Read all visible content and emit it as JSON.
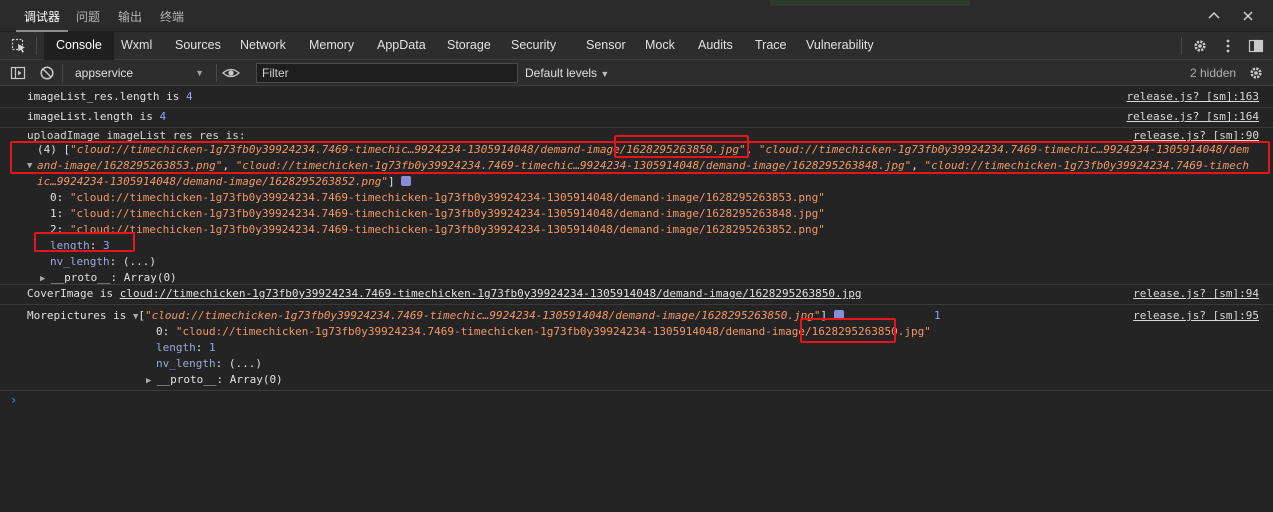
{
  "panel_tabs": [
    "调试器",
    "问题",
    "输出",
    "终端"
  ],
  "top_strip_text": "",
  "devtools_tabs": [
    "Console",
    "Wxml",
    "Sources",
    "Network",
    "Memory",
    "AppData",
    "Storage",
    "Security",
    "Sensor",
    "Mock",
    "Audits",
    "Trace",
    "Vulnerability"
  ],
  "toolbar": {
    "context": "appservice",
    "filter_placeholder": "Filter",
    "levels": "Default levels",
    "hidden": "2 hidden"
  },
  "console": {
    "m1": {
      "text": "imageList_res.length is ",
      "value": "4",
      "source": "release.js? [sm]:163"
    },
    "m2": {
      "text": "imageList.length is ",
      "value": "4",
      "source": "release.js? [sm]:164"
    },
    "m3": {
      "label": "uploadImage imageList_res_res is:",
      "source": "release.js? [sm]:90",
      "count": "(4) [",
      "line1_a": "\"cloud://timechicken-1g73fb0y39924234.7469-timechic…9924234-1305914048/demand-image/1628295263850.jpg\"",
      "line1_b": ", ",
      "line1_c": "\"cloud://timechicken-1g73fb0y39924234.7469-timechic…9924234-1305914048/dem",
      "line2_a": "and-image/1628295263853.png\"",
      "line2_b": ", ",
      "line2_c": "\"cloud://timechicken-1g73fb0y39924234.7469-timechic…9924234-1305914048/demand-image/1628295263848.jpg\"",
      "line2_d": ", ",
      "line2_e": "\"cloud://timechicken-1g73fb0y39924234.7469-timech",
      "line3_a": "ic…9924234-1305914048/demand-image/1628295263852.png\"",
      "line3_b": "]",
      "items": [
        {
          "key": "0",
          "value": "\"cloud://timechicken-1g73fb0y39924234.7469-timechicken-1g73fb0y39924234-1305914048/demand-image/1628295263853.png\""
        },
        {
          "key": "1",
          "value": "\"cloud://timechicken-1g73fb0y39924234.7469-timechicken-1g73fb0y39924234-1305914048/demand-image/1628295263848.jpg\""
        },
        {
          "key": "2",
          "value": "\"cloud://timechicken-1g73fb0y39924234.7469-timechicken-1g73fb0y39924234-1305914048/demand-image/1628295263852.png\""
        }
      ],
      "length_key": "length",
      "length_val": "3",
      "nv_key": "nv_length",
      "nv_val": "(...)",
      "proto_key": "__proto__",
      "proto_val": "Array(0)"
    },
    "m4": {
      "label": "CoverImage is ",
      "link": "cloud://timechicken-1g73fb0y39924234.7469-timechicken-1g73fb0y39924234-1305914048/demand-image/1628295263850.jpg",
      "source": "release.js? [sm]:94"
    },
    "m5": {
      "label": "Morepictures is ",
      "preview": "\"cloud://timechicken-1g73fb0y39924234.7469-timechic…9924234-1305914048/demand-image/1628295263850.jpg\"",
      "count": "1",
      "source": "release.js? [sm]:95",
      "item_key": "0",
      "item_prefix": "\"cloud://timechicken-1g73fb0y39924234.7469-timechicken-1g73fb0y39924234-1305914048/demand-image/",
      "item_mid": "1628295263850",
      "item_suffix": ".jpg\"",
      "length_key": "length",
      "length_val": "1",
      "nv_key": "nv_length",
      "nv_val": "(...)",
      "proto_key": "__proto__",
      "proto_val": "Array(0)"
    },
    "prompt": "›"
  }
}
